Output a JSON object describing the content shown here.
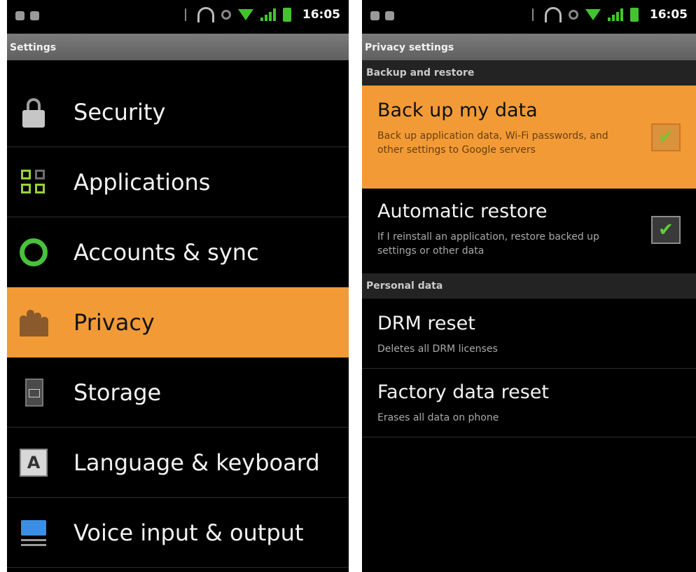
{
  "left": {
    "status_time": "16:05",
    "title": "Settings",
    "items": [
      {
        "label": "Security",
        "icon": "lock-icon"
      },
      {
        "label": "Applications",
        "icon": "applications-icon"
      },
      {
        "label": "Accounts & sync",
        "icon": "sync-icon"
      },
      {
        "label": "Privacy",
        "icon": "privacy-icon",
        "highlighted": true
      },
      {
        "label": "Storage",
        "icon": "sd-card-icon"
      },
      {
        "label": "Language & keyboard",
        "icon": "keyboard-icon"
      },
      {
        "label": "Voice input & output",
        "icon": "voice-icon"
      }
    ]
  },
  "right": {
    "status_time": "16:05",
    "title": "Privacy settings",
    "sections": [
      {
        "header": "Backup and restore",
        "items": [
          {
            "title": "Back up my data",
            "summary": "Back up application data, Wi-Fi passwords, and other settings to Google servers",
            "checked": true,
            "highlighted": true
          },
          {
            "title": "Automatic restore",
            "summary": "If I reinstall an application, restore backed up settings or other data",
            "checked": true
          }
        ]
      },
      {
        "header": "Personal data",
        "items": [
          {
            "title": "DRM reset",
            "summary": "Deletes all DRM licenses"
          },
          {
            "title": "Factory data reset",
            "summary": "Erases all data on phone"
          }
        ]
      }
    ],
    "check_glyph": "✔"
  },
  "colors": {
    "highlight": "#f29b36",
    "title_bar": "#6d6d6d",
    "green": "#43c42f"
  }
}
